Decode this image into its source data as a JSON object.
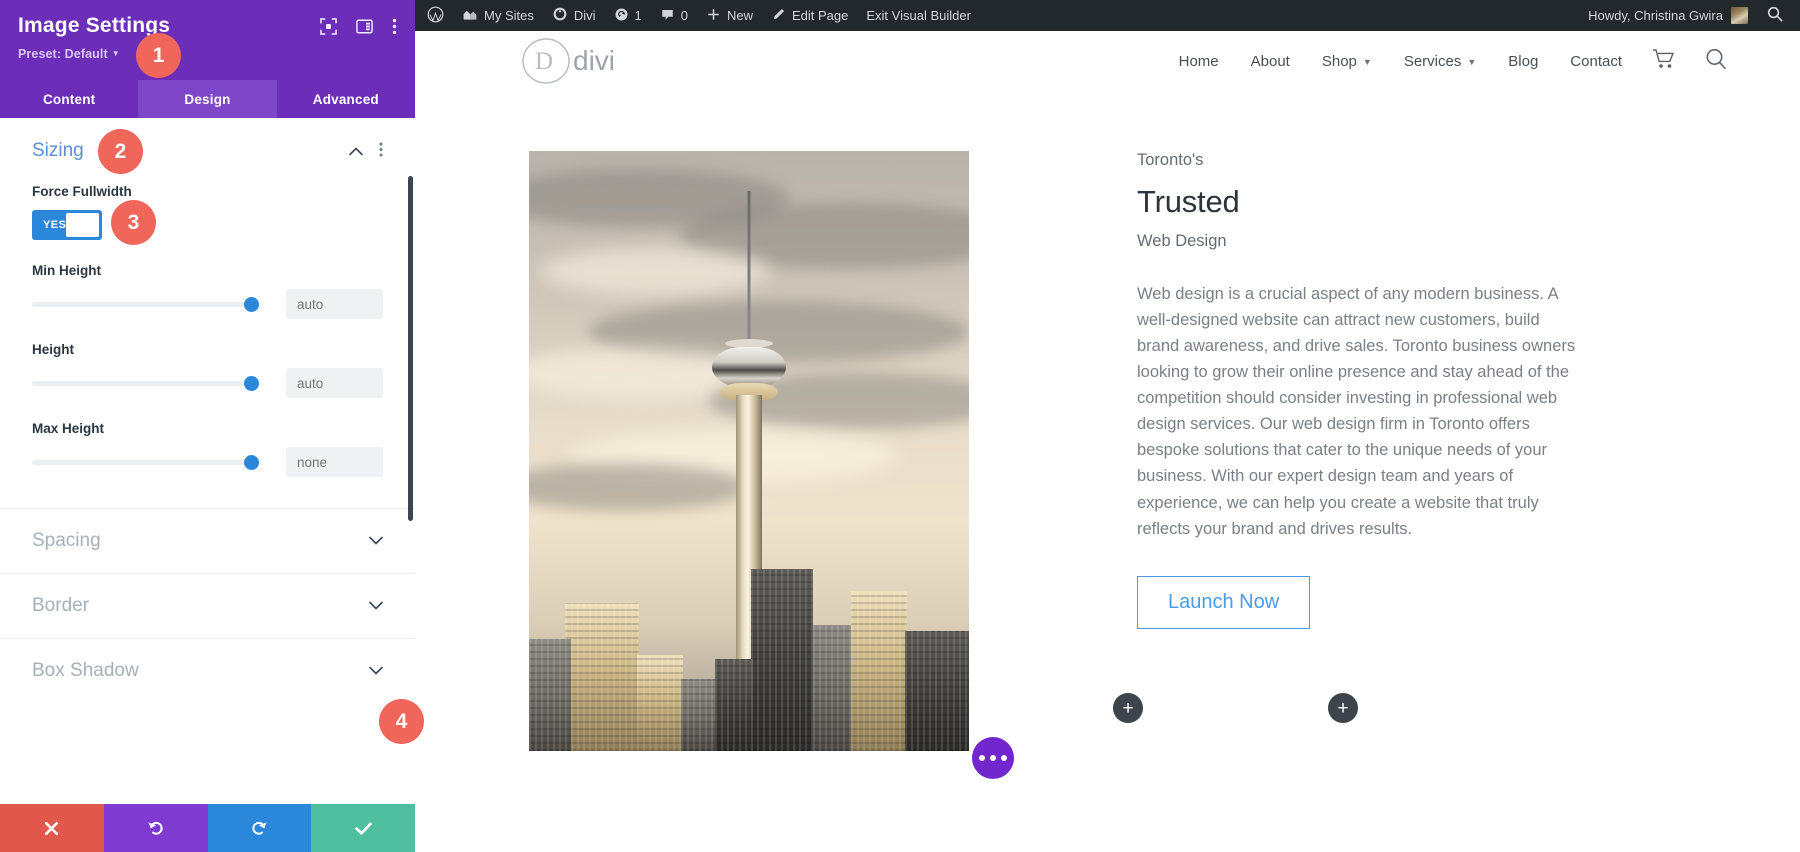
{
  "settings_panel": {
    "title": "Image Settings",
    "preset_label": "Preset: Default",
    "icons": {
      "fullscreen": "expand-icon",
      "layout": "panel-layout-icon",
      "more": "kebab-menu-icon"
    },
    "tabs": [
      {
        "label": "Content",
        "active": false
      },
      {
        "label": "Design",
        "active": true
      },
      {
        "label": "Advanced",
        "active": false
      }
    ],
    "sizing_section": {
      "title": "Sizing",
      "force_fullwidth": {
        "label": "Force Fullwidth",
        "value": "YES"
      },
      "min_height": {
        "label": "Min Height",
        "value": "",
        "placeholder": "auto"
      },
      "height": {
        "label": "Height",
        "value": "",
        "placeholder": "auto"
      },
      "max_height": {
        "label": "Max Height",
        "value": "",
        "placeholder": "none"
      }
    },
    "collapsed_sections": [
      {
        "label": "Spacing"
      },
      {
        "label": "Border"
      },
      {
        "label": "Box Shadow"
      }
    ],
    "footer_buttons": [
      {
        "name": "cancel",
        "icon": "close-icon",
        "color": "#e2574c"
      },
      {
        "name": "undo",
        "icon": "undo-icon",
        "color": "#7e3ad1"
      },
      {
        "name": "redo",
        "icon": "redo-icon",
        "color": "#2b87da"
      },
      {
        "name": "save",
        "icon": "check-icon",
        "color": "#4fbf9f"
      }
    ]
  },
  "step_badges": [
    {
      "number": "1"
    },
    {
      "number": "2"
    },
    {
      "number": "3"
    },
    {
      "number": "4"
    }
  ],
  "wp_adminbar": {
    "items": [
      {
        "label": "",
        "icon": "wordpress-logo-icon"
      },
      {
        "label": "My Sites",
        "icon": "sites-icon"
      },
      {
        "label": "Divi",
        "icon": "divi-dashboard-icon"
      },
      {
        "label": "1",
        "icon": "updates-icon"
      },
      {
        "label": "0",
        "icon": "comments-icon"
      },
      {
        "label": "New",
        "icon": "plus-icon"
      },
      {
        "label": "Edit Page",
        "icon": "pencil-icon"
      },
      {
        "label": "Exit Visual Builder",
        "icon": ""
      }
    ],
    "howdy": "Howdy, Christina Gwira",
    "search_icon": "search-icon"
  },
  "site": {
    "logo_text": "divi",
    "nav": [
      {
        "label": "Home",
        "has_dropdown": false
      },
      {
        "label": "About",
        "has_dropdown": false
      },
      {
        "label": "Shop",
        "has_dropdown": true
      },
      {
        "label": "Services",
        "has_dropdown": true
      },
      {
        "label": "Blog",
        "has_dropdown": false
      },
      {
        "label": "Contact",
        "has_dropdown": false
      }
    ],
    "nav_icons": [
      {
        "name": "cart-icon"
      },
      {
        "name": "search-icon"
      }
    ],
    "hero": {
      "eyebrow": "Toronto's",
      "headline": "Trusted",
      "subhead": "Web Design",
      "body": "Web design is a crucial aspect of any modern business. A well-designed website can attract new customers, build brand awareness, and drive sales. Toronto business owners looking to grow their online presence and stay ahead of the competition should consider investing in professional web design services. Our web design firm in Toronto offers bespoke solutions that cater to the unique needs of your business. With our expert design team and years of experience, we can help you create a website that truly reflects your brand and drives results.",
      "cta_label": "Launch Now",
      "image_alt": "CN Tower Toronto skyline"
    },
    "builder_controls": {
      "add_module_label": "+",
      "row_options_icon": "ellipsis-icon"
    }
  },
  "colors": {
    "panel_purple": "#6c2eb9",
    "tab_active": "#7e46c9",
    "badge_red": "#f0665b",
    "toggle_blue": "#2b87da",
    "section_link": "#5a8fd6",
    "cta_blue": "#4c9ae8",
    "adminbar": "#23282d"
  }
}
